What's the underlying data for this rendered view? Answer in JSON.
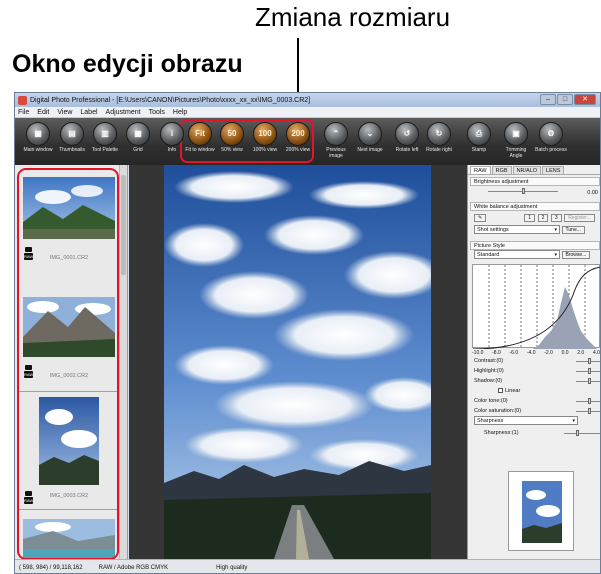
{
  "callouts": {
    "resize": "Zmiana rozmiaru",
    "editor_window": "Okno edycji obrazu"
  },
  "window": {
    "title": "Digital Photo Professional - [E:\\Users\\CANON\\Pictures\\Photo\\xxxx_xx_xx\\IMG_0003.CR2]",
    "controls": [
      "–",
      "□",
      "✕"
    ]
  },
  "menu": [
    "File",
    "Edit",
    "View",
    "Label",
    "Adjustment",
    "Tools",
    "Help"
  ],
  "toolbar": [
    {
      "label": "Main window",
      "glyph": "▦",
      "icon": "main-window-icon"
    },
    {
      "label": "Thumbnails",
      "glyph": "▤",
      "icon": "thumbnails-icon"
    },
    {
      "label": "Tool Palette",
      "glyph": "▥",
      "icon": "tool-palette-icon"
    },
    {
      "label": "Grid",
      "glyph": "▦",
      "icon": "grid-icon"
    },
    {
      "label": "Info",
      "glyph": "i",
      "icon": "info-icon"
    },
    {
      "label": "Fit to window",
      "glyph": "Fit",
      "icon": "fit-to-window-icon"
    },
    {
      "label": "50% view",
      "glyph": "50",
      "icon": "zoom-50-icon"
    },
    {
      "label": "100% view",
      "glyph": "100",
      "icon": "zoom-100-icon"
    },
    {
      "label": "200% view",
      "glyph": "200",
      "icon": "zoom-200-icon"
    },
    {
      "label": "Previous image",
      "glyph": "⌃",
      "icon": "previous-image-icon"
    },
    {
      "label": "Next image",
      "glyph": "⌄",
      "icon": "next-image-icon"
    },
    {
      "label": "Rotate left",
      "glyph": "↺",
      "icon": "rotate-left-icon"
    },
    {
      "label": "Rotate right",
      "glyph": "↻",
      "icon": "rotate-right-icon"
    },
    {
      "label": "Stamp",
      "glyph": "⎙",
      "icon": "stamp-icon"
    },
    {
      "label": "Trimming Angle",
      "glyph": "▣",
      "icon": "trimming-icon"
    },
    {
      "label": "Batch process",
      "glyph": "⚙",
      "icon": "batch-process-icon"
    }
  ],
  "thumbnails": [
    {
      "caption": "IMG_0001.CR2",
      "badge": "RAW"
    },
    {
      "caption": "IMG_0002.CR2",
      "badge": "RAW"
    },
    {
      "caption": "IMG_0003.CR2",
      "badge": "RAW"
    }
  ],
  "tool_palette": {
    "tabs": [
      "RAW",
      "RGB",
      "NR/ALO",
      "LENS"
    ],
    "brightness": {
      "label": "Brightness adjustment",
      "value": "0.00"
    },
    "white_balance": {
      "label": "White balance adjustment",
      "buttons": [
        "1",
        "2",
        "3"
      ],
      "register": "Register...",
      "select": "Shot settings",
      "tune": "Tune..."
    },
    "picture_style": {
      "label": "Picture Style",
      "select": "Standard",
      "browse": "Browse..."
    },
    "histogram_scale": [
      "-10.0",
      "-8.0",
      "-6.0",
      "-4.0",
      "-2.0",
      "0.0",
      "2.0",
      "4.0"
    ],
    "params": [
      "Contrast:(0)",
      "Highlight:(0)",
      "Shadow:(0)"
    ],
    "linear": "Linear",
    "params2": [
      "Color tone:(0)",
      "Color saturation:(0)"
    ],
    "sharpness_select": "Sharpness",
    "sharpness": "Sharpness:(1)"
  },
  "status": {
    "coords": "( 598, 984) / 99,118,162",
    "space": "RAW / Adobe RGB  CMYK",
    "quality": "High quality"
  }
}
